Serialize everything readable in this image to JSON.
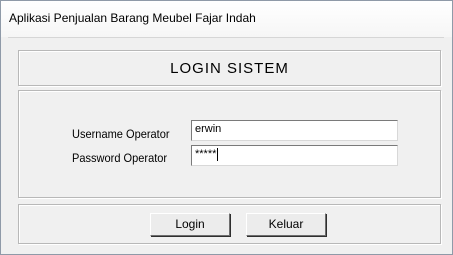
{
  "window": {
    "title": "Aplikasi Penjualan Barang Meubel Fajar Indah"
  },
  "header": {
    "heading": "LOGIN SISTEM"
  },
  "form": {
    "username_label": "Username Operator",
    "username_value": "erwin",
    "password_label": "Password Operator",
    "password_value": "*****"
  },
  "buttons": {
    "login_label": "Login",
    "keluar_label": "Keluar"
  }
}
